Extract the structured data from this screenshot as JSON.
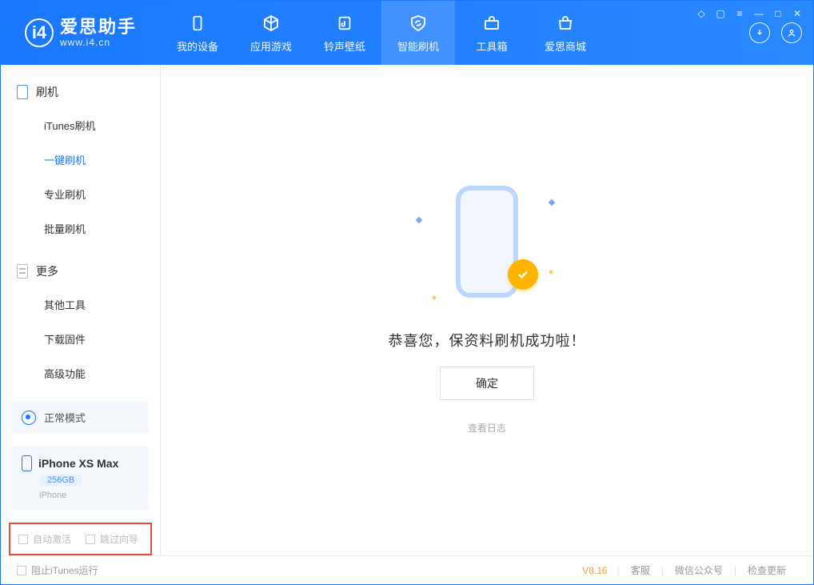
{
  "app": {
    "name": "爱思助手",
    "domain": "www.i4.cn"
  },
  "tabs": {
    "device": "我的设备",
    "apps": "应用游戏",
    "ring": "铃声壁纸",
    "flash": "智能刷机",
    "tools": "工具箱",
    "store": "爱思商城"
  },
  "sidebar": {
    "group_flash": "刷机",
    "items_flash": {
      "itunes": "iTunes刷机",
      "oneclick": "一键刷机",
      "pro": "专业刷机",
      "batch": "批量刷机"
    },
    "group_more": "更多",
    "items_more": {
      "other": "其他工具",
      "download": "下载固件",
      "advanced": "高级功能"
    },
    "mode_card": "正常模式",
    "device": {
      "name": "iPhone XS Max",
      "storage": "256GB",
      "type": "iPhone"
    },
    "opts": {
      "auto_activate": "自动激活",
      "skip_guide": "跳过向导"
    }
  },
  "main": {
    "success_msg": "恭喜您，保资料刷机成功啦！",
    "ok_btn": "确定",
    "view_log": "查看日志"
  },
  "footer": {
    "block_itunes": "阻止iTunes运行",
    "version": "V8.16",
    "cs": "客服",
    "wechat": "微信公众号",
    "update": "检查更新"
  }
}
